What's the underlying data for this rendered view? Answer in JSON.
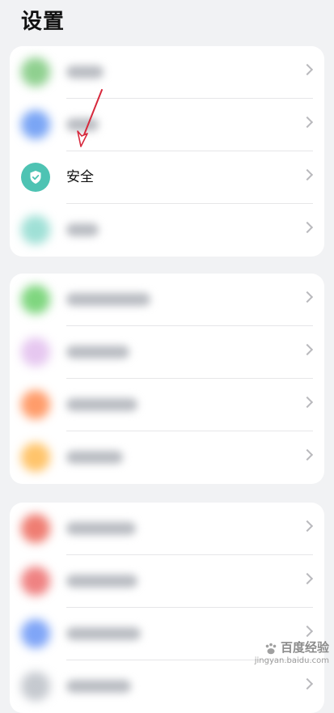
{
  "page": {
    "title": "设置"
  },
  "groups": [
    {
      "items": [
        {
          "id": "blurred-1",
          "label": "",
          "icon_color": "#8fd08f",
          "blurred": true
        },
        {
          "id": "blurred-2",
          "label": "",
          "icon_color": "#7aa5f5",
          "blurred": true
        },
        {
          "id": "security",
          "label": "安全",
          "icon": "shield-check-icon",
          "icon_color": "#4ec3b3",
          "blurred": false
        },
        {
          "id": "blurred-4",
          "label": "",
          "icon_color": "#9fe0d6",
          "blurred": true
        }
      ]
    },
    {
      "items": [
        {
          "id": "blurred-5",
          "label": "",
          "icon_color": "#7fd67f",
          "blurred": true
        },
        {
          "id": "blurred-6",
          "label": "",
          "icon_color": "#e6c7f0",
          "blurred": true
        },
        {
          "id": "blurred-7",
          "label": "",
          "icon_color": "#ff9c6a",
          "blurred": true
        },
        {
          "id": "blurred-8",
          "label": "",
          "icon_color": "#ffc46b",
          "blurred": true
        }
      ]
    },
    {
      "items": [
        {
          "id": "blurred-9",
          "label": "",
          "icon_color": "#ef7d72",
          "blurred": true
        },
        {
          "id": "blurred-10",
          "label": "",
          "icon_color": "#ef8282",
          "blurred": true
        },
        {
          "id": "blurred-11",
          "label": "",
          "icon_color": "#7fa5f7",
          "blurred": true
        },
        {
          "id": "blurred-12",
          "label": "",
          "icon_color": "#c5c9cf",
          "blurred": true
        }
      ]
    }
  ],
  "annotation": {
    "arrow_color": "#d7283c"
  },
  "watermark": {
    "site_name": "百度经验",
    "url": "jingyan.baidu.com"
  }
}
